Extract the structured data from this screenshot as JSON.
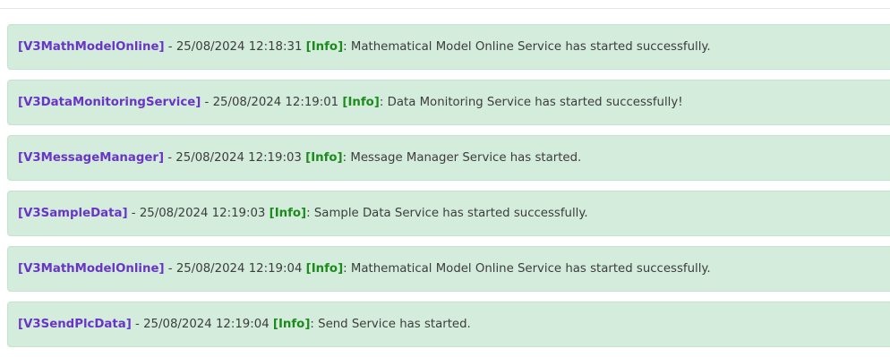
{
  "log": {
    "entries": [
      {
        "service": "[V3MathModelOnline]",
        "timestamp": "25/08/2024 12:18:31",
        "level": "[Info]",
        "message": "Mathematical Model Online Service has started successfully."
      },
      {
        "service": "[V3DataMonitoringService]",
        "timestamp": "25/08/2024 12:19:01",
        "level": "[Info]",
        "message": "Data Monitoring Service has started successfully!"
      },
      {
        "service": "[V3MessageManager]",
        "timestamp": "25/08/2024 12:19:03",
        "level": "[Info]",
        "message": "Message Manager Service has started."
      },
      {
        "service": "[V3SampleData]",
        "timestamp": "25/08/2024 12:19:03",
        "level": "[Info]",
        "message": "Sample Data Service has started successfully."
      },
      {
        "service": "[V3MathModelOnline]",
        "timestamp": "25/08/2024 12:19:04",
        "level": "[Info]",
        "message": "Mathematical Model Online Service has started successfully."
      },
      {
        "service": "[V3SendPlcData]",
        "timestamp": "25/08/2024 12:19:04",
        "level": "[Info]",
        "message": "Send Service has started."
      }
    ]
  },
  "colors": {
    "entry_background": "#d3ecdc",
    "service_name": "#6a35c7",
    "info_level": "#1e8a1e",
    "text": "#3d3d3d"
  }
}
